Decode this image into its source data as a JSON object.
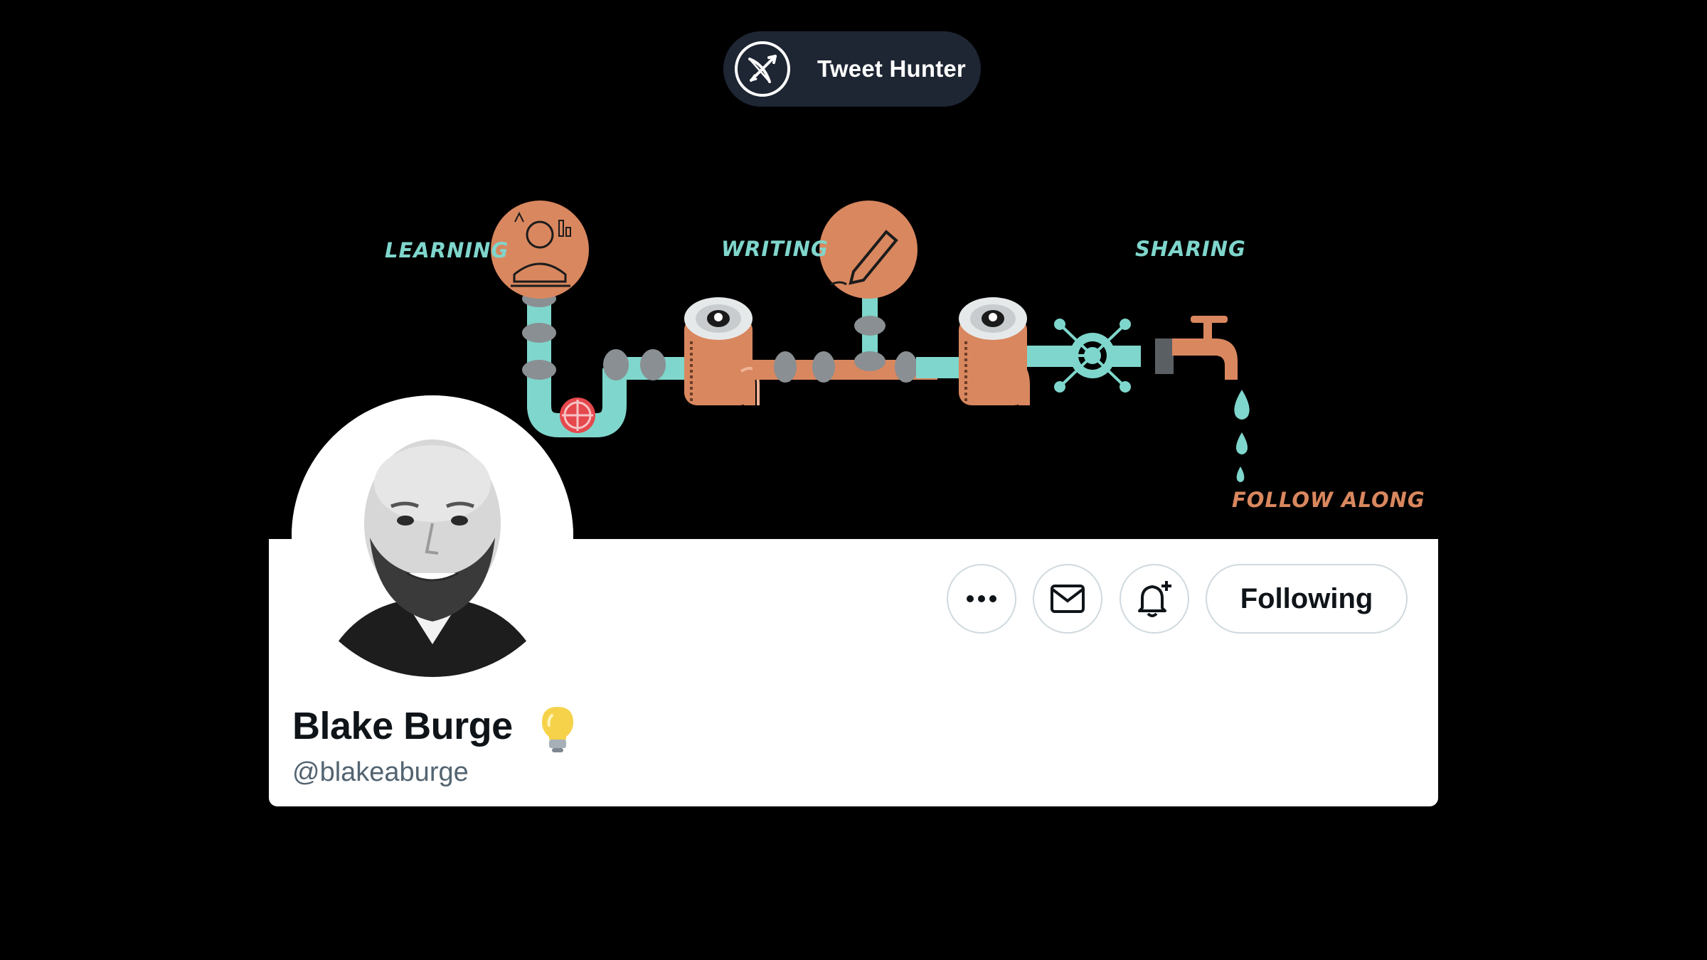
{
  "brand": {
    "name": "Tweet Hunter",
    "logo_icon": "bow-and-arrow-icon"
  },
  "banner": {
    "labels": {
      "learning": "LEARNING",
      "writing": "WRITING",
      "sharing": "SHARING",
      "follow_along": "FOLLOW ALONG"
    },
    "colors": {
      "pipe": "#7fd6cc",
      "copper": "#d9875f",
      "label_teal": "#7fd6cc",
      "label_orange": "#d9875f",
      "valve": "#e5484d"
    }
  },
  "profile": {
    "display_name": "Blake Burge",
    "name_emoji": "💡",
    "handle": "@blakeaburge",
    "avatar_icon": "avatar"
  },
  "actions": {
    "more": "more-options-icon",
    "message": "envelope-icon",
    "notify": "bell-plus-icon",
    "following_label": "Following"
  },
  "colors": {
    "background": "#000000",
    "pill": "#1e2533",
    "card": "#ffffff",
    "text_primary": "#0f1419",
    "text_secondary": "#536471",
    "button_border": "#cfd9de"
  }
}
